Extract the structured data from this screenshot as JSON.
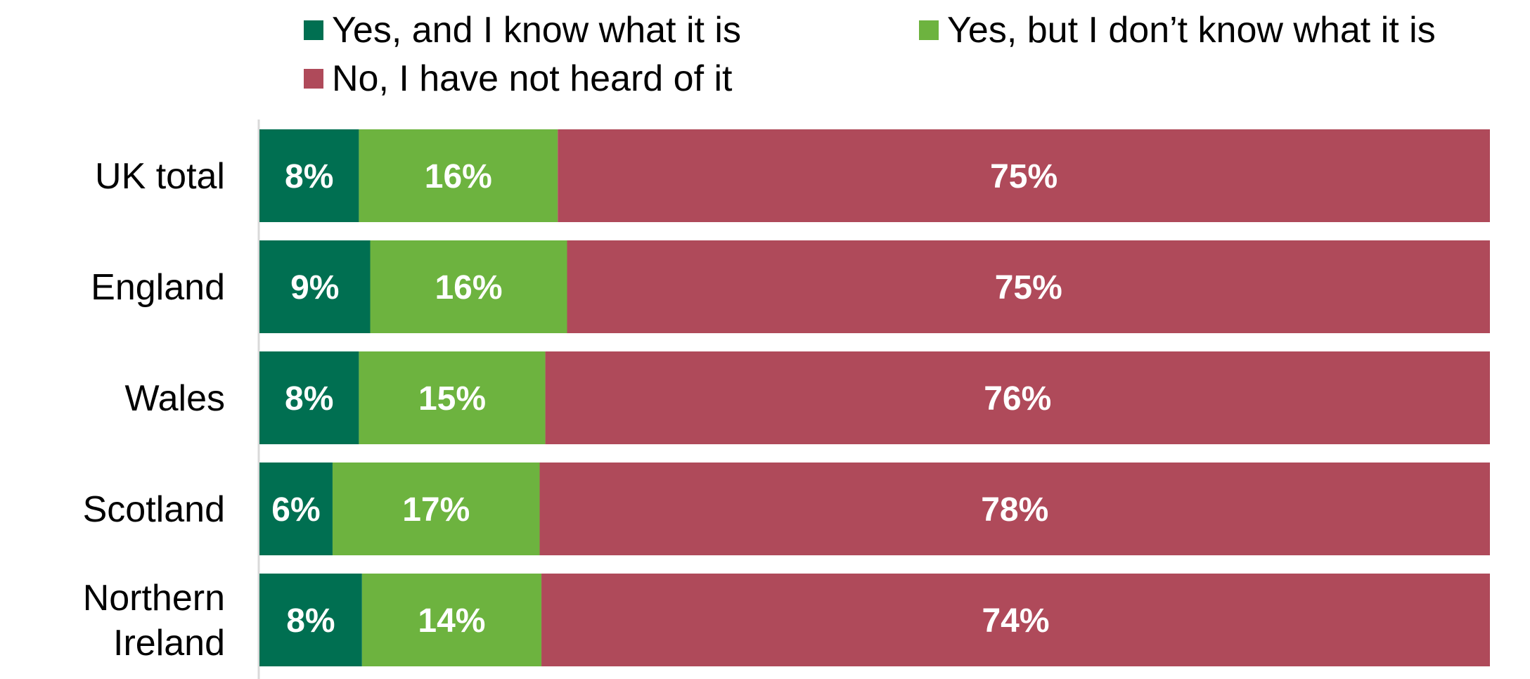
{
  "chart_data": {
    "type": "bar",
    "orientation": "horizontal",
    "stacked": true,
    "title": "",
    "xlabel": "",
    "ylabel": "",
    "xlim": [
      0,
      100
    ],
    "grid": false,
    "legend_position": "top",
    "value_format": "percent",
    "categories": [
      "UK total",
      "England",
      "Wales",
      "Scotland",
      "Northern Ireland"
    ],
    "category_lines": [
      [
        "UK total"
      ],
      [
        "England"
      ],
      [
        "Wales"
      ],
      [
        "Scotland"
      ],
      [
        "Northern",
        "Ireland"
      ]
    ],
    "series": [
      {
        "name": "Yes, and I know what it is",
        "color": "#006F51",
        "values": [
          8,
          9,
          8,
          6,
          8
        ]
      },
      {
        "name": "Yes, but I don’t know what it is",
        "color": "#6DB33F",
        "values": [
          16,
          16,
          15,
          17,
          14
        ]
      },
      {
        "name": "No, I have not heard of it",
        "color": "#AF4A5A",
        "values": [
          75,
          75,
          76,
          78,
          74
        ]
      }
    ],
    "data_labels": [
      [
        "8%",
        "16%",
        "75%"
      ],
      [
        "9%",
        "16%",
        "75%"
      ],
      [
        "8%",
        "15%",
        "76%"
      ],
      [
        "6%",
        "17%",
        "78%"
      ],
      [
        "8%",
        "14%",
        "74%"
      ]
    ]
  }
}
